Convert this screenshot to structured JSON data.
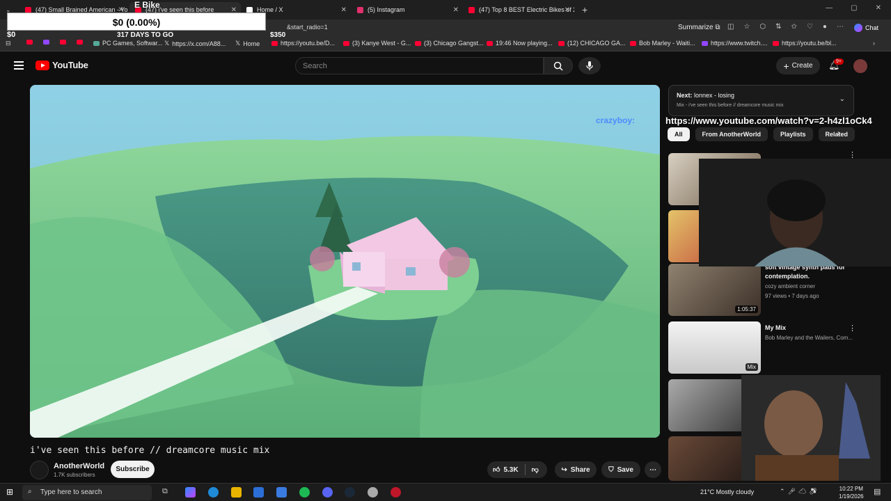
{
  "tabs": [
    {
      "title": "(47) Small Brained American - You",
      "color": "#ff0033"
    },
    {
      "title": "(47) i've seen this before",
      "color": "#ff0033"
    },
    {
      "title": "Home / X",
      "color": "#ffffff"
    },
    {
      "title": "(5) Instagram",
      "color": "#e1306c"
    },
    {
      "title": "(47) Top 8 BEST Electric Bikes of 20",
      "color": "#ff0033"
    }
  ],
  "window_controls": {
    "minimize": "—",
    "maximize": "▢",
    "close": "✕"
  },
  "address_bar": {
    "url_fragment": "&start_radio=1",
    "summarize": "Summarize",
    "chat": "Chat"
  },
  "bookmarks": [
    {
      "label": "PC Games, Softwar...",
      "icon": "game-icon"
    },
    {
      "label": "https://x.com/A88...",
      "icon": "x-icon"
    },
    {
      "label": "Home",
      "icon": "x-icon"
    },
    {
      "label": "https://youtu.be/D...",
      "icon": "youtube-icon"
    },
    {
      "label": "(3) Kanye West - G...",
      "icon": "youtube-icon"
    },
    {
      "label": "(3) Chicago Gangst...",
      "icon": "youtube-icon"
    },
    {
      "label": "19:46 Now playing...",
      "icon": "youtube-icon"
    },
    {
      "label": "(12) CHICAGO GA...",
      "icon": "youtube-icon"
    },
    {
      "label": "Bob Marley - Waiti...",
      "icon": "youtube-icon"
    },
    {
      "label": "https://www.twitch....",
      "icon": "twitch-icon"
    },
    {
      "label": "https://youtu.be/bl...",
      "icon": "youtube-icon"
    }
  ],
  "overlay": {
    "ebike": "E Bike",
    "progress": "$0 (0.00%)",
    "start": "$0",
    "days": "317 DAYS TO GO",
    "goal": "$350"
  },
  "youtube": {
    "logo": "YouTube",
    "search_placeholder": "Search",
    "create": "Create",
    "notifications": "9+"
  },
  "video": {
    "title": "i've seen this before // dreamcore music mix",
    "channel": "AnotherWorld",
    "subscribers": "1.7K subscribers",
    "subscribe": "Subscribe",
    "likes": "5.3K",
    "share": "Share",
    "save": "Save"
  },
  "up_next": {
    "label": "Next:",
    "song": "lonnex - losing",
    "mix": "Mix - i've seen this before // dreamcore music mix"
  },
  "stream_overlay": {
    "url": "https://www.youtube.com/watch?v=2-h4zl1oCk4",
    "user": "crazyboy:"
  },
  "chips": [
    "All",
    "From AnotherWorld",
    "Playlists",
    "Related"
  ],
  "related": [
    {
      "title": "",
      "meta1": "",
      "meta2": "",
      "duration": ""
    },
    {
      "title": "",
      "meta1": "",
      "meta2": "",
      "duration": ""
    },
    {
      "title": "soft vintage synth pads for contemplation.",
      "meta1": "cozy ambient corner",
      "meta2": "97 views • 7 days ago",
      "duration": "1:05:37"
    },
    {
      "title": "My Mix",
      "meta1": "Bob Marley and the Wailers, Com...",
      "meta2": "",
      "duration": "Mix"
    }
  ],
  "taskbar": {
    "search_placeholder": "Type here to search",
    "weather": "21°C  Mostly cloudy",
    "time": "10:22 PM",
    "date": "1/19/2026"
  }
}
